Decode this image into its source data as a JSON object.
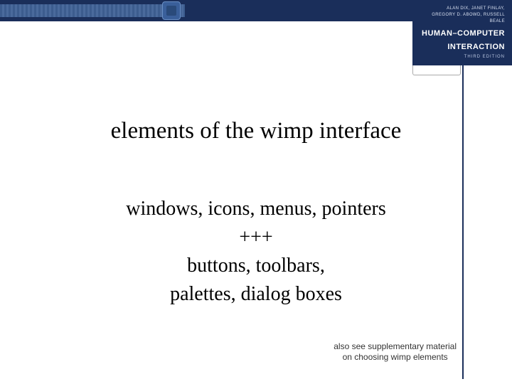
{
  "book": {
    "authors_line1": "ALAN DIX, JANET FINLAY,",
    "authors_line2": "GREGORY D. ABOWD, RUSSELL BEALE",
    "title_line1": "HUMAN–COMPUTER",
    "title_line2": "INTERACTION",
    "edition": "THIRD EDITION"
  },
  "slide": {
    "title": "elements of the wimp interface",
    "body": [
      "windows, icons, menus, pointers",
      "+++",
      "buttons, toolbars,",
      "palettes, dialog boxes"
    ],
    "footnote": [
      "also see supplementary  material",
      "on choosing wimp elements"
    ]
  }
}
